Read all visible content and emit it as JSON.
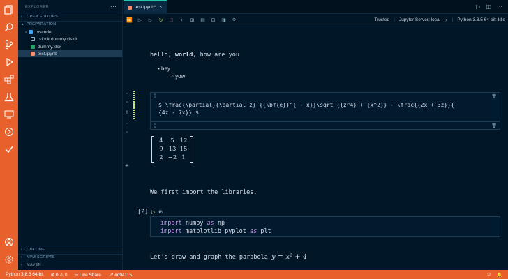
{
  "sidebar": {
    "title": "EXPLORER",
    "sections": {
      "open_editors": "OPEN EDITORS",
      "preparation": "PREPARATION",
      "outline": "OUTLINE",
      "npm_scripts": "NPM SCRIPTS",
      "maven": "MAVEN"
    },
    "items": [
      {
        "label": ".vscode",
        "icon": "folder-icon",
        "color": "#42a5f5"
      },
      {
        "label": ".~lock.dummy.xlsx#",
        "icon": "file-icon",
        "color": "#8badc1"
      },
      {
        "label": "dummy.xlsx",
        "icon": "excel-icon",
        "color": "#21a366"
      },
      {
        "label": "test.ipynb",
        "icon": "notebook-icon",
        "color": "#f78c6c"
      }
    ]
  },
  "tabs": [
    {
      "label": "test.ipynb*"
    }
  ],
  "toolbar": {
    "trusted": "Trusted",
    "server": "Jupyter Server: local",
    "kernel": "Python 3.8.5 64-bit: Idle"
  },
  "notebook": {
    "md1": {
      "prefix": "hello, ",
      "bold": "world",
      "suffix": ", how are you"
    },
    "bullet1": "hey",
    "bullet2": "yow",
    "cell_tag": "{}",
    "latex_line1": "$ \\frac{\\partial}{\\partial z} {{\\bf{e}}^{ - x}}\\sqrt {{z^4} + {x^2}}  - \\frac{{2x + 3z}}{",
    "latex_line2": "{4z - 7x}} $",
    "matrix": [
      [
        "4",
        "5",
        "12"
      ],
      [
        "9",
        "13",
        "15"
      ],
      [
        "2",
        "−2",
        "1"
      ]
    ],
    "md2": "We first import the libraries.",
    "exec_count": "[2]",
    "run_time": "ℹ6",
    "code": [
      {
        "kw": "import",
        "mod": " numpy ",
        "as": "as",
        "alias": " np"
      },
      {
        "kw": "import",
        "mod": " matplotlib.pyplot ",
        "as": "as",
        "alias": " plt"
      }
    ],
    "md3": "Let's draw and graph the parabola ",
    "md3_math": "y = x² + 4"
  },
  "status": {
    "python": "Python 3.8.5 64-bit",
    "problems": "⊗ 0 ⚠ 0",
    "liveshare": "Live Share",
    "commit": "#d94115"
  },
  "colors": {
    "accent": "#e8602b",
    "bg": "#011627",
    "teal": "#21c7a8"
  }
}
